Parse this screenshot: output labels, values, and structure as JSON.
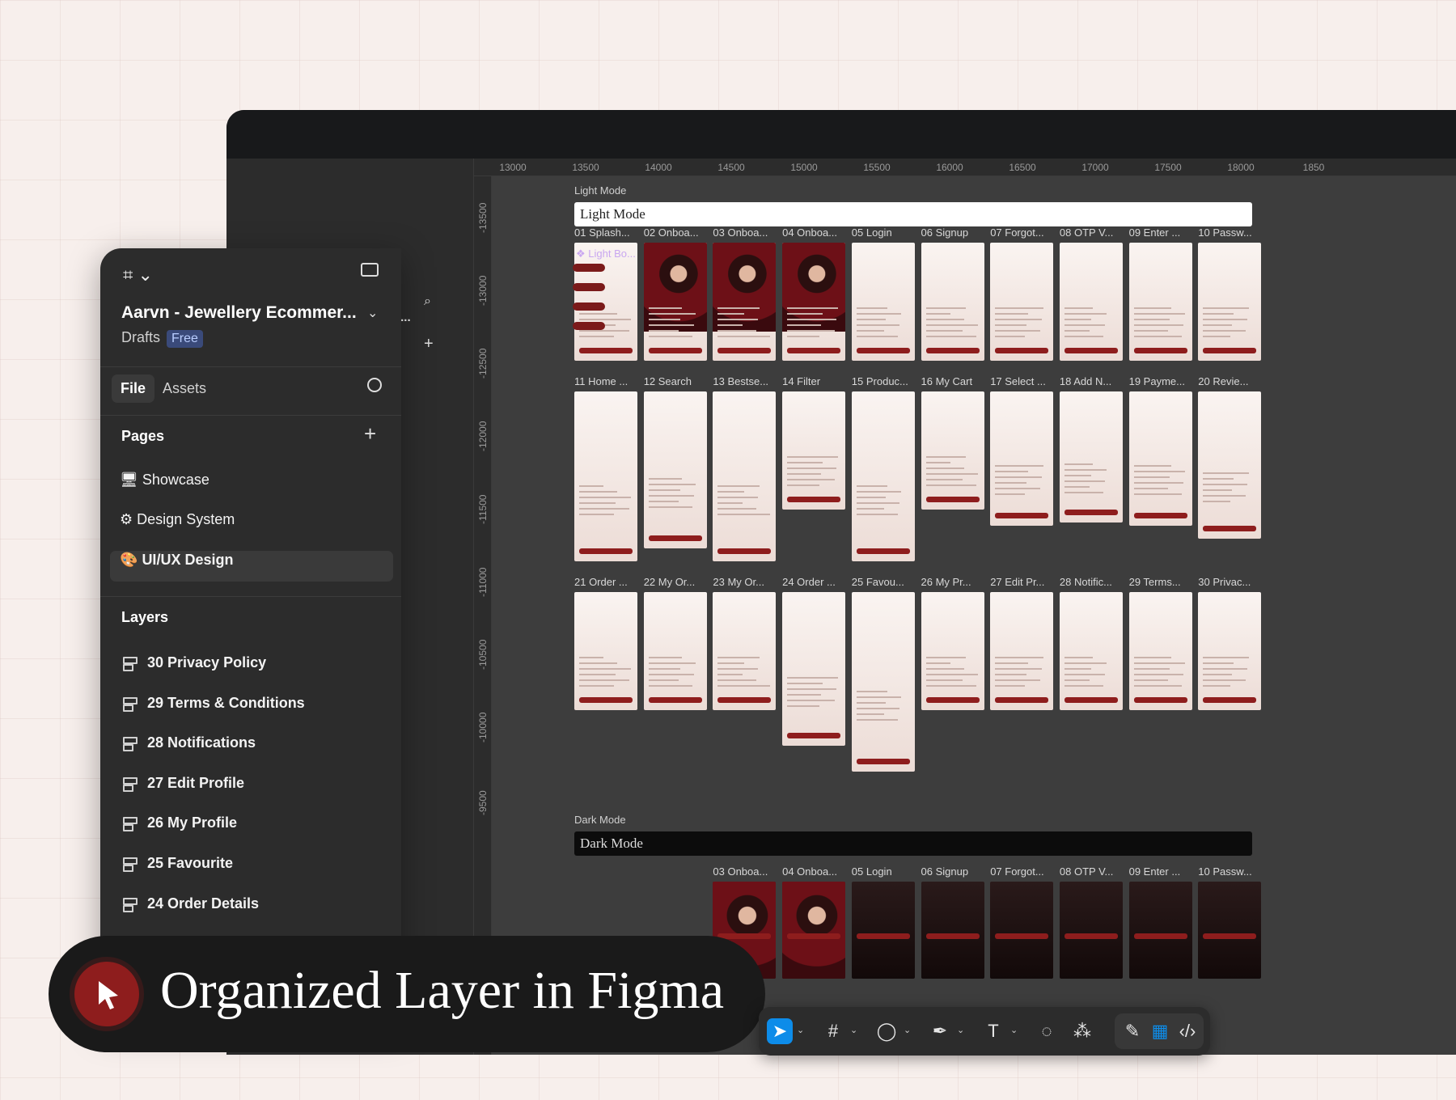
{
  "app": {
    "file_name": "Aarvn - Jewellery Ecommer...",
    "location": "Drafts",
    "plan_badge": "Free"
  },
  "tabs": {
    "file": "File",
    "assets": "Assets"
  },
  "pages": {
    "heading": "Pages",
    "items": [
      {
        "label": "Showcase",
        "icon": "monitor-icon",
        "glyph": "🖥"
      },
      {
        "label": "Design System",
        "icon": "gear-icon",
        "glyph": "⚙"
      },
      {
        "label": "UI/UX Design",
        "icon": "palette-icon",
        "glyph": "🎨",
        "selected": true
      }
    ]
  },
  "layers": {
    "heading": "Layers",
    "items": [
      "30 Privacy Policy",
      "29 Terms & Conditions",
      "28 Notifications",
      "27 Edit Profile",
      "26 My Profile",
      "25 Favourite",
      "24 Order Details"
    ]
  },
  "ruler": {
    "top": [
      "13000",
      "13500",
      "14000",
      "14500",
      "15000",
      "15500",
      "16000",
      "16500",
      "17000",
      "17500",
      "18000",
      "1850"
    ],
    "left": [
      "-13500",
      "-13000",
      "-12500",
      "-12000",
      "-11500",
      "-11000",
      "-10500",
      "-10000",
      "-9500"
    ]
  },
  "canvas": {
    "light_section_label": "Light Mode",
    "light_bar_title": "Light Mode",
    "dark_section_label": "Dark Mode",
    "dark_bar_title": "Dark Mode",
    "component_label": "❖ Light Bo...",
    "rows": [
      [
        "01 Splash...",
        "02 Onboa...",
        "03 Onboa...",
        "04 Onboa...",
        "05 Login",
        "06 Signup",
        "07 Forgot...",
        "08 OTP V...",
        "09 Enter ...",
        "10 Passw..."
      ],
      [
        "11 Home ...",
        "12 Search",
        "13 Bestse...",
        "14 Filter",
        "15 Produc...",
        "16 My Cart",
        "17 Select ...",
        "18 Add N...",
        "19 Payme...",
        "20 Revie..."
      ],
      [
        "21 Order ...",
        "22 My Or...",
        "23 My Or...",
        "24 Order ...",
        "25 Favou...",
        "26 My Pr...",
        "27 Edit Pr...",
        "28 Notific...",
        "29 Terms...",
        "30 Privac..."
      ]
    ],
    "dark_row": [
      "03 Onboa...",
      "04 Onboa...",
      "05 Login",
      "06 Signup",
      "07 Forgot...",
      "08 OTP V...",
      "09 Enter ...",
      "10 Passw..."
    ]
  },
  "banner": {
    "text": "Organized Layer in Figma"
  },
  "colors": {
    "accent": "#8e1d1d",
    "active_tool": "#0d8ce9"
  }
}
